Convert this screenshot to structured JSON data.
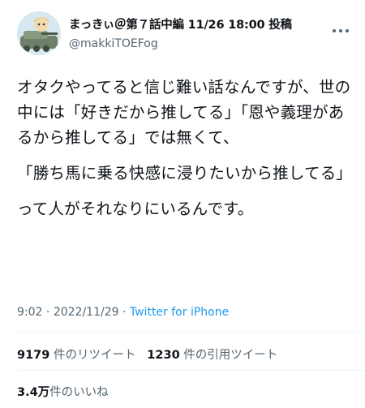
{
  "user": {
    "display_name": "まっきぃ＠第７話中編 11/26 18:00 投稿",
    "handle": "@makkiTOEFog"
  },
  "tweet": {
    "paragraphs": [
      "オタクやってると信じ難い話なんですが、世の中には「好きだから推してる」「恩や義理があるから推してる」では無くて、",
      "「勝ち馬に乗る快感に浸りたいから推してる」",
      "って人がそれなりにいるんです。"
    ],
    "time": "9:02",
    "separator1": "·",
    "date": "2022/11/29",
    "separator2": "·",
    "source": "Twitter for iPhone"
  },
  "stats": {
    "retweets": "9179",
    "retweets_label": "件のリツイート",
    "quotes": "1230",
    "quotes_label": "件の引用ツイート",
    "likes": "3.4万",
    "likes_label": "件のいいね"
  },
  "icons": {
    "avatar": "user-avatar",
    "more": "more-options-icon"
  }
}
